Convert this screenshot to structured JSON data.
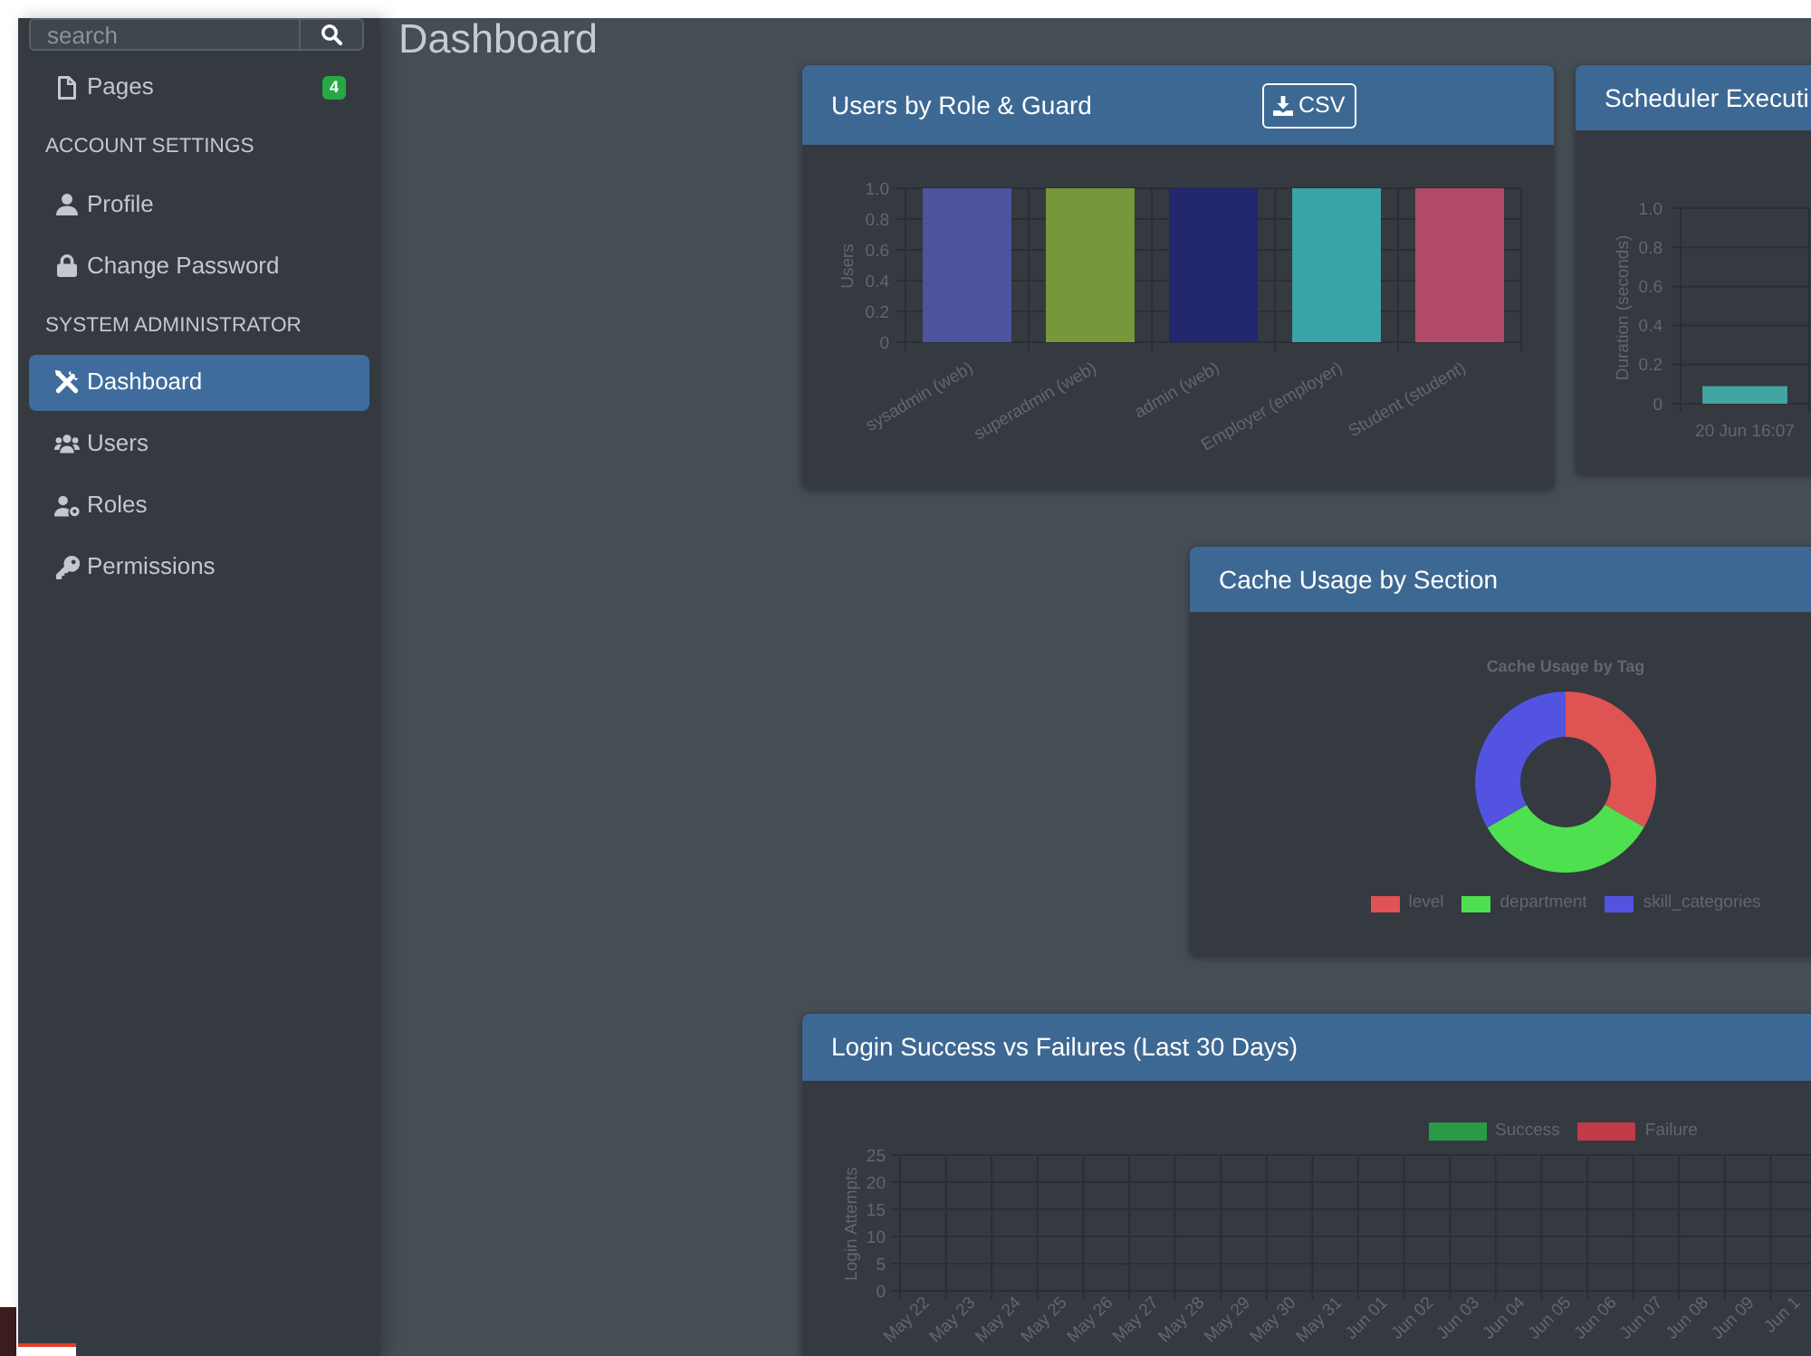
{
  "page": {
    "title": "Dashboard"
  },
  "sidebar": {
    "search": {
      "placeholder": "search"
    },
    "sections": [
      {
        "items": [
          {
            "label": "Pages",
            "badge": "4",
            "selected": false
          }
        ]
      },
      {
        "title": "ACCOUNT SETTINGS",
        "items": [
          {
            "label": "Profile",
            "selected": false
          },
          {
            "label": "Change Password",
            "selected": false
          }
        ]
      },
      {
        "title": "SYSTEM ADMINISTRATOR",
        "items": [
          {
            "label": "Dashboard",
            "selected": true
          },
          {
            "label": "Users",
            "selected": false
          },
          {
            "label": "Roles",
            "selected": false
          },
          {
            "label": "Permissions",
            "selected": false
          }
        ]
      }
    ]
  },
  "cards": [
    {
      "title": "Users by Role & Guard",
      "button": {
        "label": "CSV"
      },
      "chart_data": {
        "type": "bar",
        "ylabel": "Users",
        "categories": [
          "sysadmin (web)",
          "superadmin (web)",
          "admin (web)",
          "Employer (employer)",
          "Student (student)"
        ],
        "series": [
          {
            "colors": [
              "#4b549c",
              "#76973a",
              "#22276e",
              "#3aa3a8",
              "#b24b67"
            ],
            "values": [
              1,
              1,
              1,
              1,
              1
            ]
          }
        ],
        "ylim": [
          0,
          1
        ],
        "yticks": [
          0,
          0.2,
          0.4,
          0.6,
          0.8,
          {
            "value": 1,
            "label": "1.0"
          }
        ],
        "grid": true
      }
    },
    {
      "title": "Scheduler Executi",
      "chart_data": {
        "type": "bar",
        "ylabel": "Duration (seconds)",
        "categories": [
          "20 Jun 16:07"
        ],
        "series": [
          {
            "color": "#42a5a2",
            "values": [
              0.09
            ]
          }
        ],
        "ylim": [
          0,
          1
        ],
        "yticks": [
          0,
          0.2,
          0.4,
          0.6,
          0.8,
          {
            "value": 1,
            "label": "1.0"
          }
        ],
        "grid": true
      }
    },
    {
      "title": "Cache Usage by Section",
      "legend": true,
      "chart_data": {
        "type": "donut",
        "title": "Cache Usage by Tag",
        "categories": [
          "level",
          "department",
          "skill_categories"
        ],
        "series": [
          {
            "colors": [
              "#e05353",
              "#4fe04f",
              "#5353e2"
            ],
            "values": [
              33.3,
              33.3,
              33.4
            ]
          }
        ]
      }
    },
    {
      "title": "Login Success vs Failures (Last 30 Days)",
      "legend": true,
      "chart_data": {
        "type": "bar",
        "ylabel": "Login Attempts",
        "categories": [
          "May 22",
          "May 23",
          "May 24",
          "May 25",
          "May 26",
          "May 27",
          "May 28",
          "May 29",
          "May 30",
          "May 31",
          "Jun 01",
          "Jun 02",
          "Jun 03",
          "Jun 04",
          "Jun 05",
          "Jun 06",
          "Jun 07",
          "Jun 08",
          "Jun 09",
          "Jun 1"
        ],
        "series": [
          {
            "name": "Success",
            "color": "#2a9a48",
            "values": [
              0,
              0,
              0,
              0,
              0,
              0,
              0,
              0,
              0,
              0,
              0,
              0,
              0,
              0,
              0,
              0,
              0,
              0,
              0,
              0
            ]
          },
          {
            "name": "Failure",
            "color": "#c33a49",
            "values": [
              0,
              0,
              0,
              0,
              0,
              0,
              0,
              0,
              0,
              0,
              0,
              0,
              0,
              0,
              0,
              0,
              0,
              0,
              0,
              0
            ]
          }
        ],
        "ylim": [
          0,
          25
        ],
        "yticks": [
          0,
          5,
          10,
          15,
          20,
          25
        ],
        "grid": true
      }
    }
  ]
}
